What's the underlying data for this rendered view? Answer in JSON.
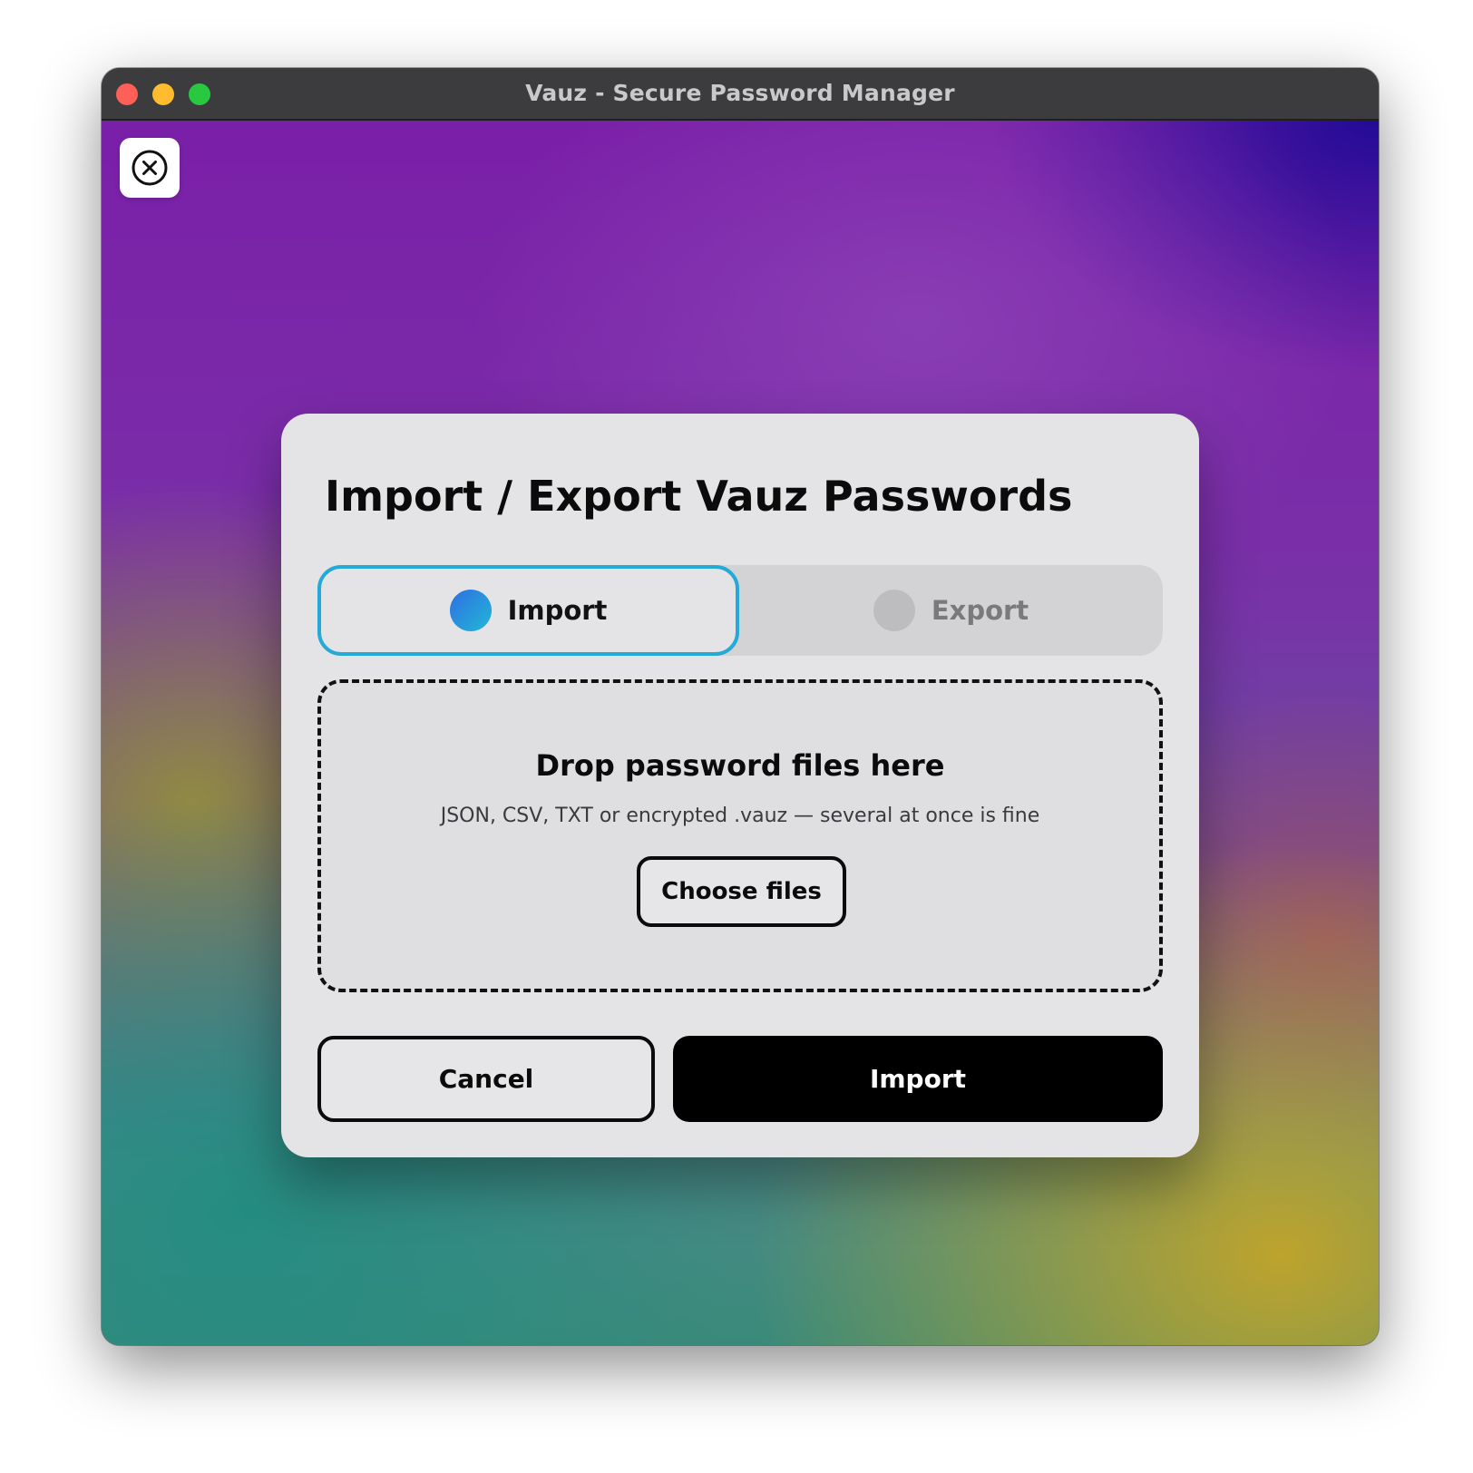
{
  "window": {
    "title": "Vauz - Secure Password Manager"
  },
  "dialog": {
    "title": "Import / Export Vauz Passwords",
    "tabs": [
      {
        "label": "Import",
        "selected": true
      },
      {
        "label": "Export",
        "selected": false
      }
    ],
    "dropzone": {
      "title": "Drop password files here",
      "subtitle": "JSON, CSV, TXT or encrypted .vauz — several at once is fine",
      "choose_label": "Choose files"
    },
    "actions": {
      "cancel_label": "Cancel",
      "primary_label": "Import"
    }
  },
  "icons": {
    "close": "close-circle-icon"
  },
  "colors": {
    "accent_gradient_start": "#2f6ee0",
    "accent_gradient_end": "#21b8d8",
    "primary_button": "#000000",
    "dialog_background": "#e4e4e6"
  }
}
